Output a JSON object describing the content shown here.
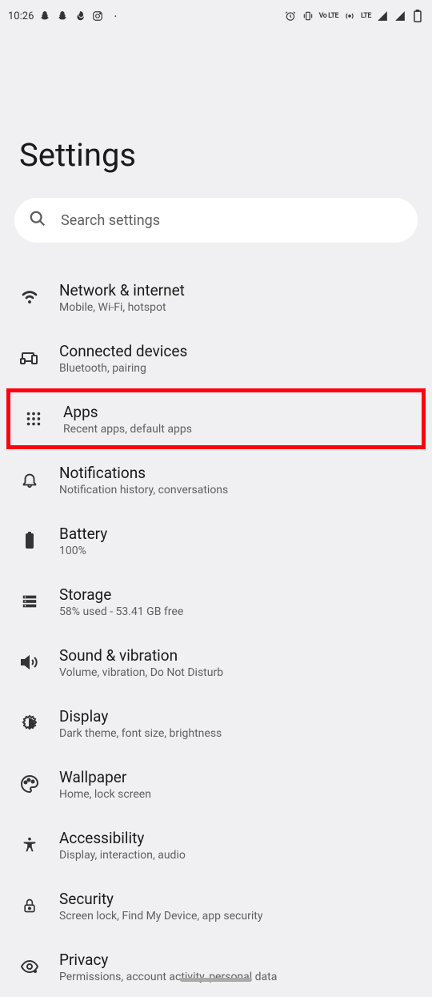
{
  "status_bar": {
    "time": "10:26",
    "lte_label": "LTE",
    "volte_label": "Vo LTE"
  },
  "page_title": "Settings",
  "search": {
    "placeholder": "Search settings"
  },
  "items": [
    {
      "title": "Network & internet",
      "subtitle": "Mobile, Wi-Fi, hotspot",
      "icon": "wifi-icon"
    },
    {
      "title": "Connected devices",
      "subtitle": "Bluetooth, pairing",
      "icon": "devices-icon"
    },
    {
      "title": "Apps",
      "subtitle": "Recent apps, default apps",
      "icon": "apps-icon"
    },
    {
      "title": "Notifications",
      "subtitle": "Notification history, conversations",
      "icon": "bell-icon"
    },
    {
      "title": "Battery",
      "subtitle": "100%",
      "icon": "battery-icon"
    },
    {
      "title": "Storage",
      "subtitle": "58% used - 53.41 GB free",
      "icon": "storage-icon"
    },
    {
      "title": "Sound & vibration",
      "subtitle": "Volume, vibration, Do Not Disturb",
      "icon": "sound-icon"
    },
    {
      "title": "Display",
      "subtitle": "Dark theme, font size, brightness",
      "icon": "brightness-icon"
    },
    {
      "title": "Wallpaper",
      "subtitle": "Home, lock screen",
      "icon": "palette-icon"
    },
    {
      "title": "Accessibility",
      "subtitle": "Display, interaction, audio",
      "icon": "accessibility-icon"
    },
    {
      "title": "Security",
      "subtitle": "Screen lock, Find My Device, app security",
      "icon": "lock-icon"
    },
    {
      "title": "Privacy",
      "subtitle": "Permissions, account activity, personal data",
      "icon": "privacy-icon"
    }
  ]
}
